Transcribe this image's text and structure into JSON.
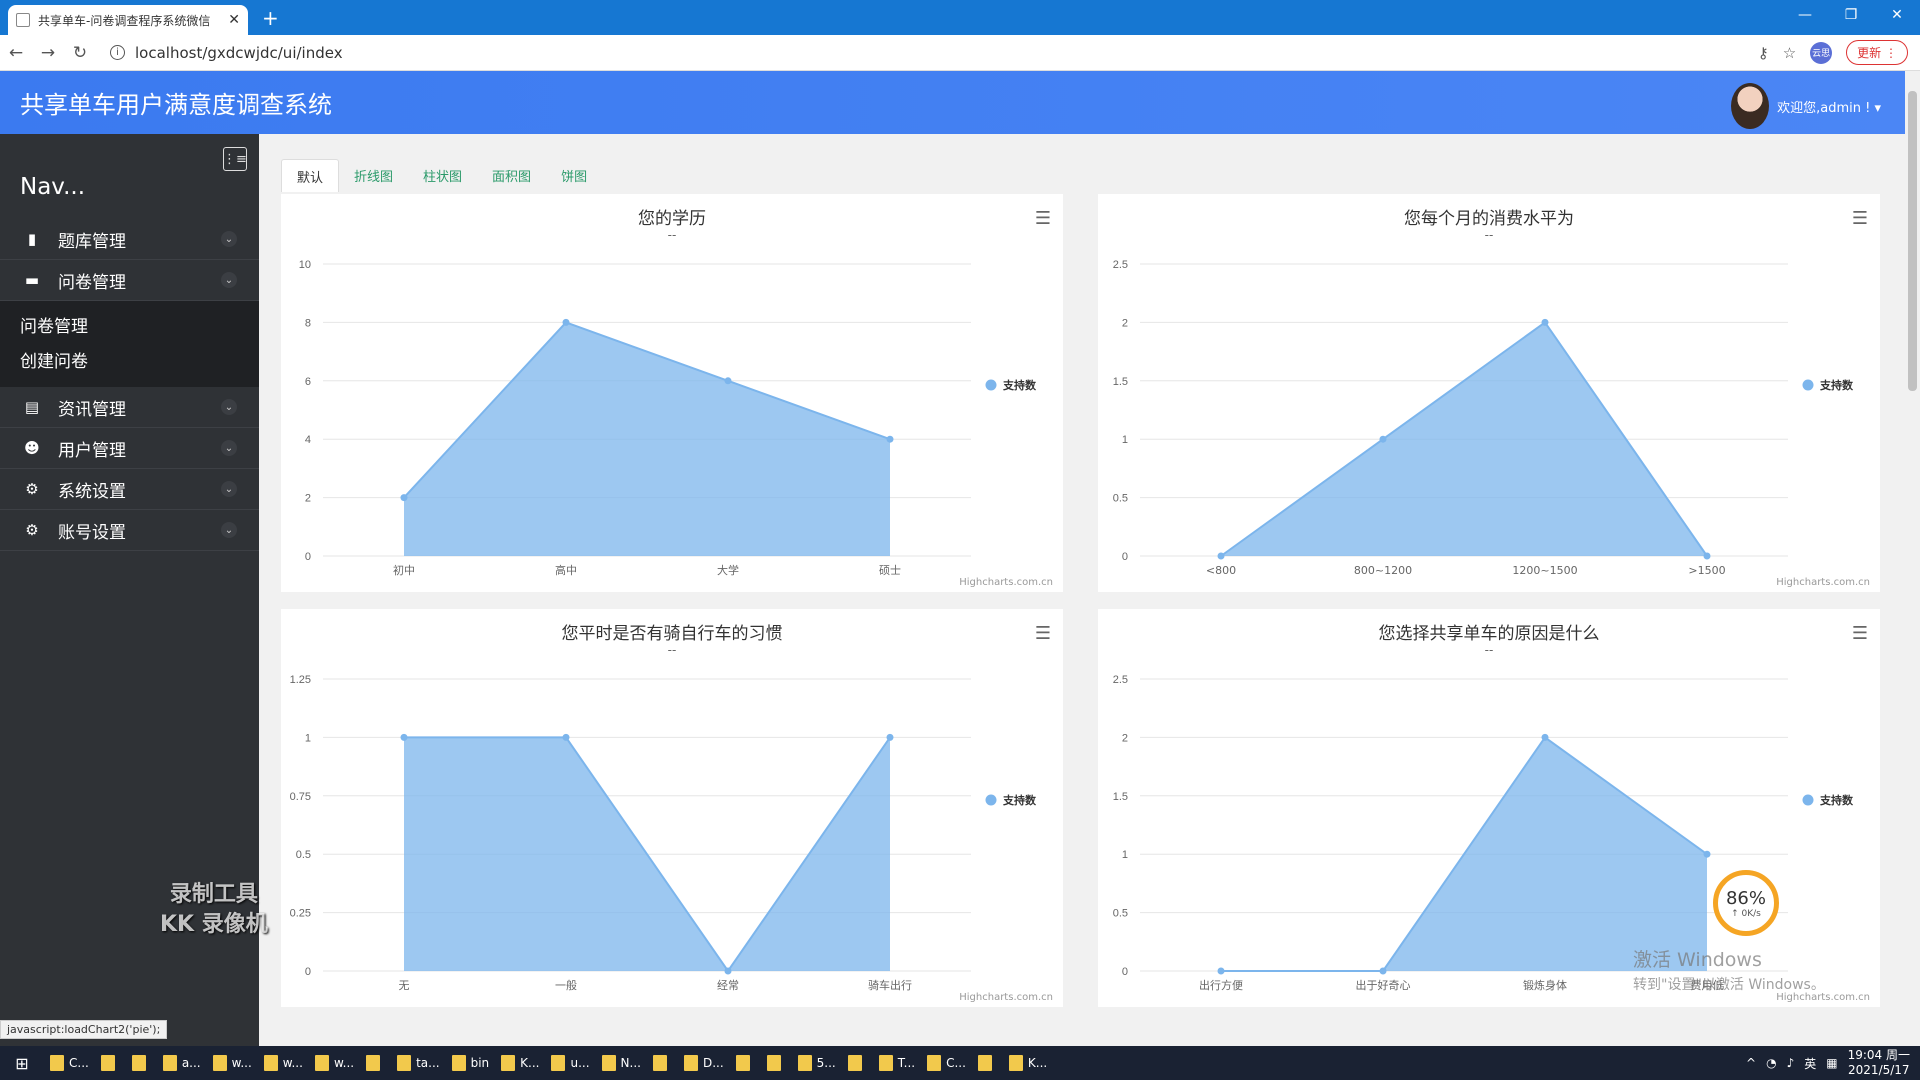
{
  "browser": {
    "tab_title": "共享单车-问卷调查程序系统微信",
    "url": "localhost/gxdcwjdc/ui/index",
    "update_label": "更新",
    "profile_initials": "云思"
  },
  "header": {
    "app_title": "共享单车用户满意度调查系统",
    "welcome": "欢迎您,admin ! ▾"
  },
  "sidebar": {
    "nav_label": "Nav...",
    "items": [
      {
        "label": "题库管理",
        "icon": "file-icon"
      },
      {
        "label": "问卷管理",
        "icon": "folder-icon"
      },
      {
        "label": "资讯管理",
        "icon": "document-icon"
      },
      {
        "label": "用户管理",
        "icon": "users-icon"
      },
      {
        "label": "系统设置",
        "icon": "gears-icon"
      },
      {
        "label": "账号设置",
        "icon": "gears-icon"
      }
    ],
    "submenu": [
      "问卷管理",
      "创建问卷"
    ]
  },
  "content_tabs": [
    "默认",
    "折线图",
    "柱状图",
    "面积图",
    "饼图"
  ],
  "charts": {
    "legend_label": "支持数",
    "subtitle": "--",
    "credit": "Highcharts.com.cn"
  },
  "chart_data": [
    {
      "type": "area",
      "title": "您的学历",
      "subtitle": "--",
      "categories": [
        "初中",
        "高中",
        "大学",
        "硕士"
      ],
      "series": [
        {
          "name": "支持数",
          "values": [
            2,
            8,
            6,
            4
          ]
        }
      ],
      "ylim": [
        0,
        10
      ],
      "yticks": [
        0,
        2,
        4,
        6,
        8,
        10
      ],
      "grid": true,
      "legend": "right"
    },
    {
      "type": "area",
      "title": "您每个月的消费水平为",
      "subtitle": "--",
      "categories": [
        "<800",
        "800~1200",
        "1200~1500",
        ">1500"
      ],
      "series": [
        {
          "name": "支持数",
          "values": [
            0,
            1,
            2,
            0
          ]
        }
      ],
      "ylim": [
        0,
        2.5
      ],
      "yticks": [
        0,
        0.5,
        1,
        1.5,
        2,
        2.5
      ],
      "grid": true,
      "legend": "right"
    },
    {
      "type": "area",
      "title": "您平时是否有骑自行车的习惯",
      "subtitle": "--",
      "categories": [
        "无",
        "一般",
        "经常",
        "骑车出行"
      ],
      "series": [
        {
          "name": "支持数",
          "values": [
            1,
            1,
            0,
            1
          ]
        }
      ],
      "ylim": [
        0,
        1.25
      ],
      "yticks": [
        0,
        0.25,
        0.5,
        0.75,
        1,
        1.25
      ],
      "grid": true,
      "legend": "right"
    },
    {
      "type": "area",
      "title": "您选择共享单车的原因是什么",
      "subtitle": "--",
      "categories": [
        "出行方便",
        "出于好奇心",
        "锻炼身体",
        "费用低"
      ],
      "series": [
        {
          "name": "支持数",
          "values": [
            0,
            0,
            2,
            1
          ]
        }
      ],
      "ylim": [
        0,
        2.5
      ],
      "yticks": [
        0,
        0.5,
        1,
        1.5,
        2,
        2.5
      ],
      "grid": true,
      "legend": "right"
    }
  ],
  "overlays": {
    "recorder_line1": "录制工具",
    "recorder_line2": "KK 录像机",
    "status_tip": "javascript:loadChart2('pie');",
    "win_activate_1": "激活 Windows",
    "win_activate_2": "转到\"设置\"以激活 Windows。",
    "speed_percent": "86%",
    "speed_rate": "↑ 0K/s"
  },
  "taskbar": {
    "items": [
      "C...",
      "",
      "",
      "a...",
      "w...",
      "w...",
      "w...",
      "",
      "ta...",
      "bin",
      "K...",
      "u...",
      "N...",
      "",
      "D...",
      "",
      "",
      "5...",
      "",
      "T...",
      "C...",
      "",
      "K..."
    ],
    "ime": "英",
    "time": "19:04 周一",
    "date": "2021/5/17"
  }
}
